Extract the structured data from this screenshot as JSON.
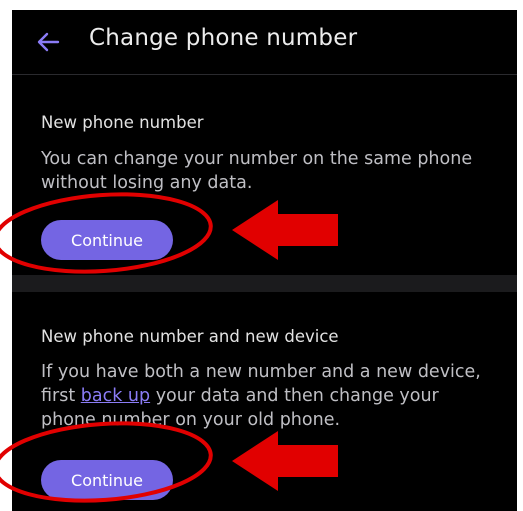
{
  "header": {
    "title": "Change phone number",
    "back_icon": "arrow-left-icon"
  },
  "option1": {
    "heading": "New phone number",
    "description": "You can change your number on the same phone without losing any data.",
    "button_label": "Continue"
  },
  "option2": {
    "heading": "New phone number and new device",
    "description_prefix": "If you have both a new number and a new device, first ",
    "link_text": "back up",
    "description_suffix": " your data and then change your phone number on your old phone.",
    "button_label": "Continue"
  },
  "colors": {
    "background": "#000000",
    "accent": "#7465e3",
    "link": "#8b7cf6",
    "annotation": "#e10000"
  }
}
